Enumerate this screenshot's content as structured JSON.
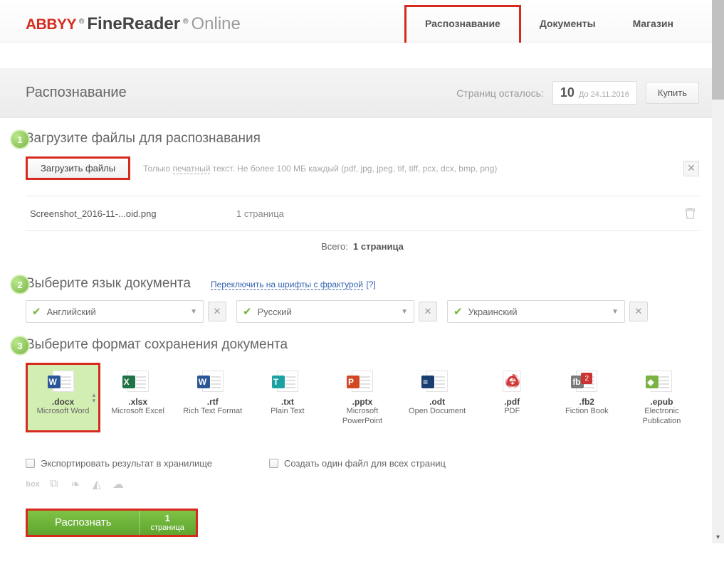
{
  "logo": {
    "brand": "ABBYY",
    "product": "FineReader",
    "suffix": "Online"
  },
  "nav": {
    "active_index": 0,
    "items": [
      "Распознавание",
      "Документы",
      "Магазин"
    ]
  },
  "title_bar": {
    "title": "Распознавание",
    "pages_left_label": "Страниц осталось:",
    "pages_count": "10",
    "pages_until": "До 24.11.2016",
    "buy": "Купить"
  },
  "step1": {
    "badge": "1",
    "title": "Загрузите файлы для распознавания",
    "upload_btn": "Загрузить файлы",
    "hint_prefix": "Только ",
    "hint_dashed": "печатный",
    "hint_suffix": " текст. Не более 100 МБ каждый (pdf, jpg, jpeg, tif, tiff, pcx, dcx, bmp, png)",
    "file": {
      "name": "Screenshot_2016-11-...oid.png",
      "pages": "1 страница"
    },
    "total_label": "Всего:",
    "total_value": "1 страница"
  },
  "step2": {
    "badge": "2",
    "title": "Выберите язык документа",
    "switch_link": "Переключить на шрифты с фрактурой",
    "help": "[?]",
    "langs": [
      "Английский",
      "Русский",
      "Украинский"
    ]
  },
  "step3": {
    "badge": "3",
    "title": "Выберите формат сохранения документа",
    "formats": [
      {
        "ext": ".docx",
        "desc": "Microsoft Word",
        "letter": "W",
        "cls": "badge-blue",
        "selected": true
      },
      {
        "ext": ".xlsx",
        "desc": "Microsoft Excel",
        "letter": "X",
        "cls": "badge-green"
      },
      {
        "ext": ".rtf",
        "desc": "Rich Text Format",
        "letter": "W",
        "cls": "badge-blue2"
      },
      {
        "ext": ".txt",
        "desc": "Plain Text",
        "letter": "T",
        "cls": "badge-teal"
      },
      {
        "ext": ".pptx",
        "desc": "Microsoft PowerPoint",
        "letter": "P",
        "cls": "badge-orange"
      },
      {
        "ext": ".odt",
        "desc": "Open Document",
        "letter": "≡",
        "cls": "badge-darkblue"
      },
      {
        "ext": ".pdf",
        "desc": "PDF",
        "letter": "",
        "cls": "pdf"
      },
      {
        "ext": ".fb2",
        "desc": "Fiction Book",
        "letter": "fb",
        "cls": "badge-grey",
        "corner": "2"
      },
      {
        "ext": ".epub",
        "desc": "Electronic Publication",
        "letter": "◆",
        "cls": "badge-lime"
      }
    ]
  },
  "export": {
    "to_storage": "Экспортировать результат в хранилище",
    "single_file": "Создать один файл для всех страниц"
  },
  "recognize": {
    "label": "Распознать",
    "count": "1",
    "unit": "страница"
  }
}
